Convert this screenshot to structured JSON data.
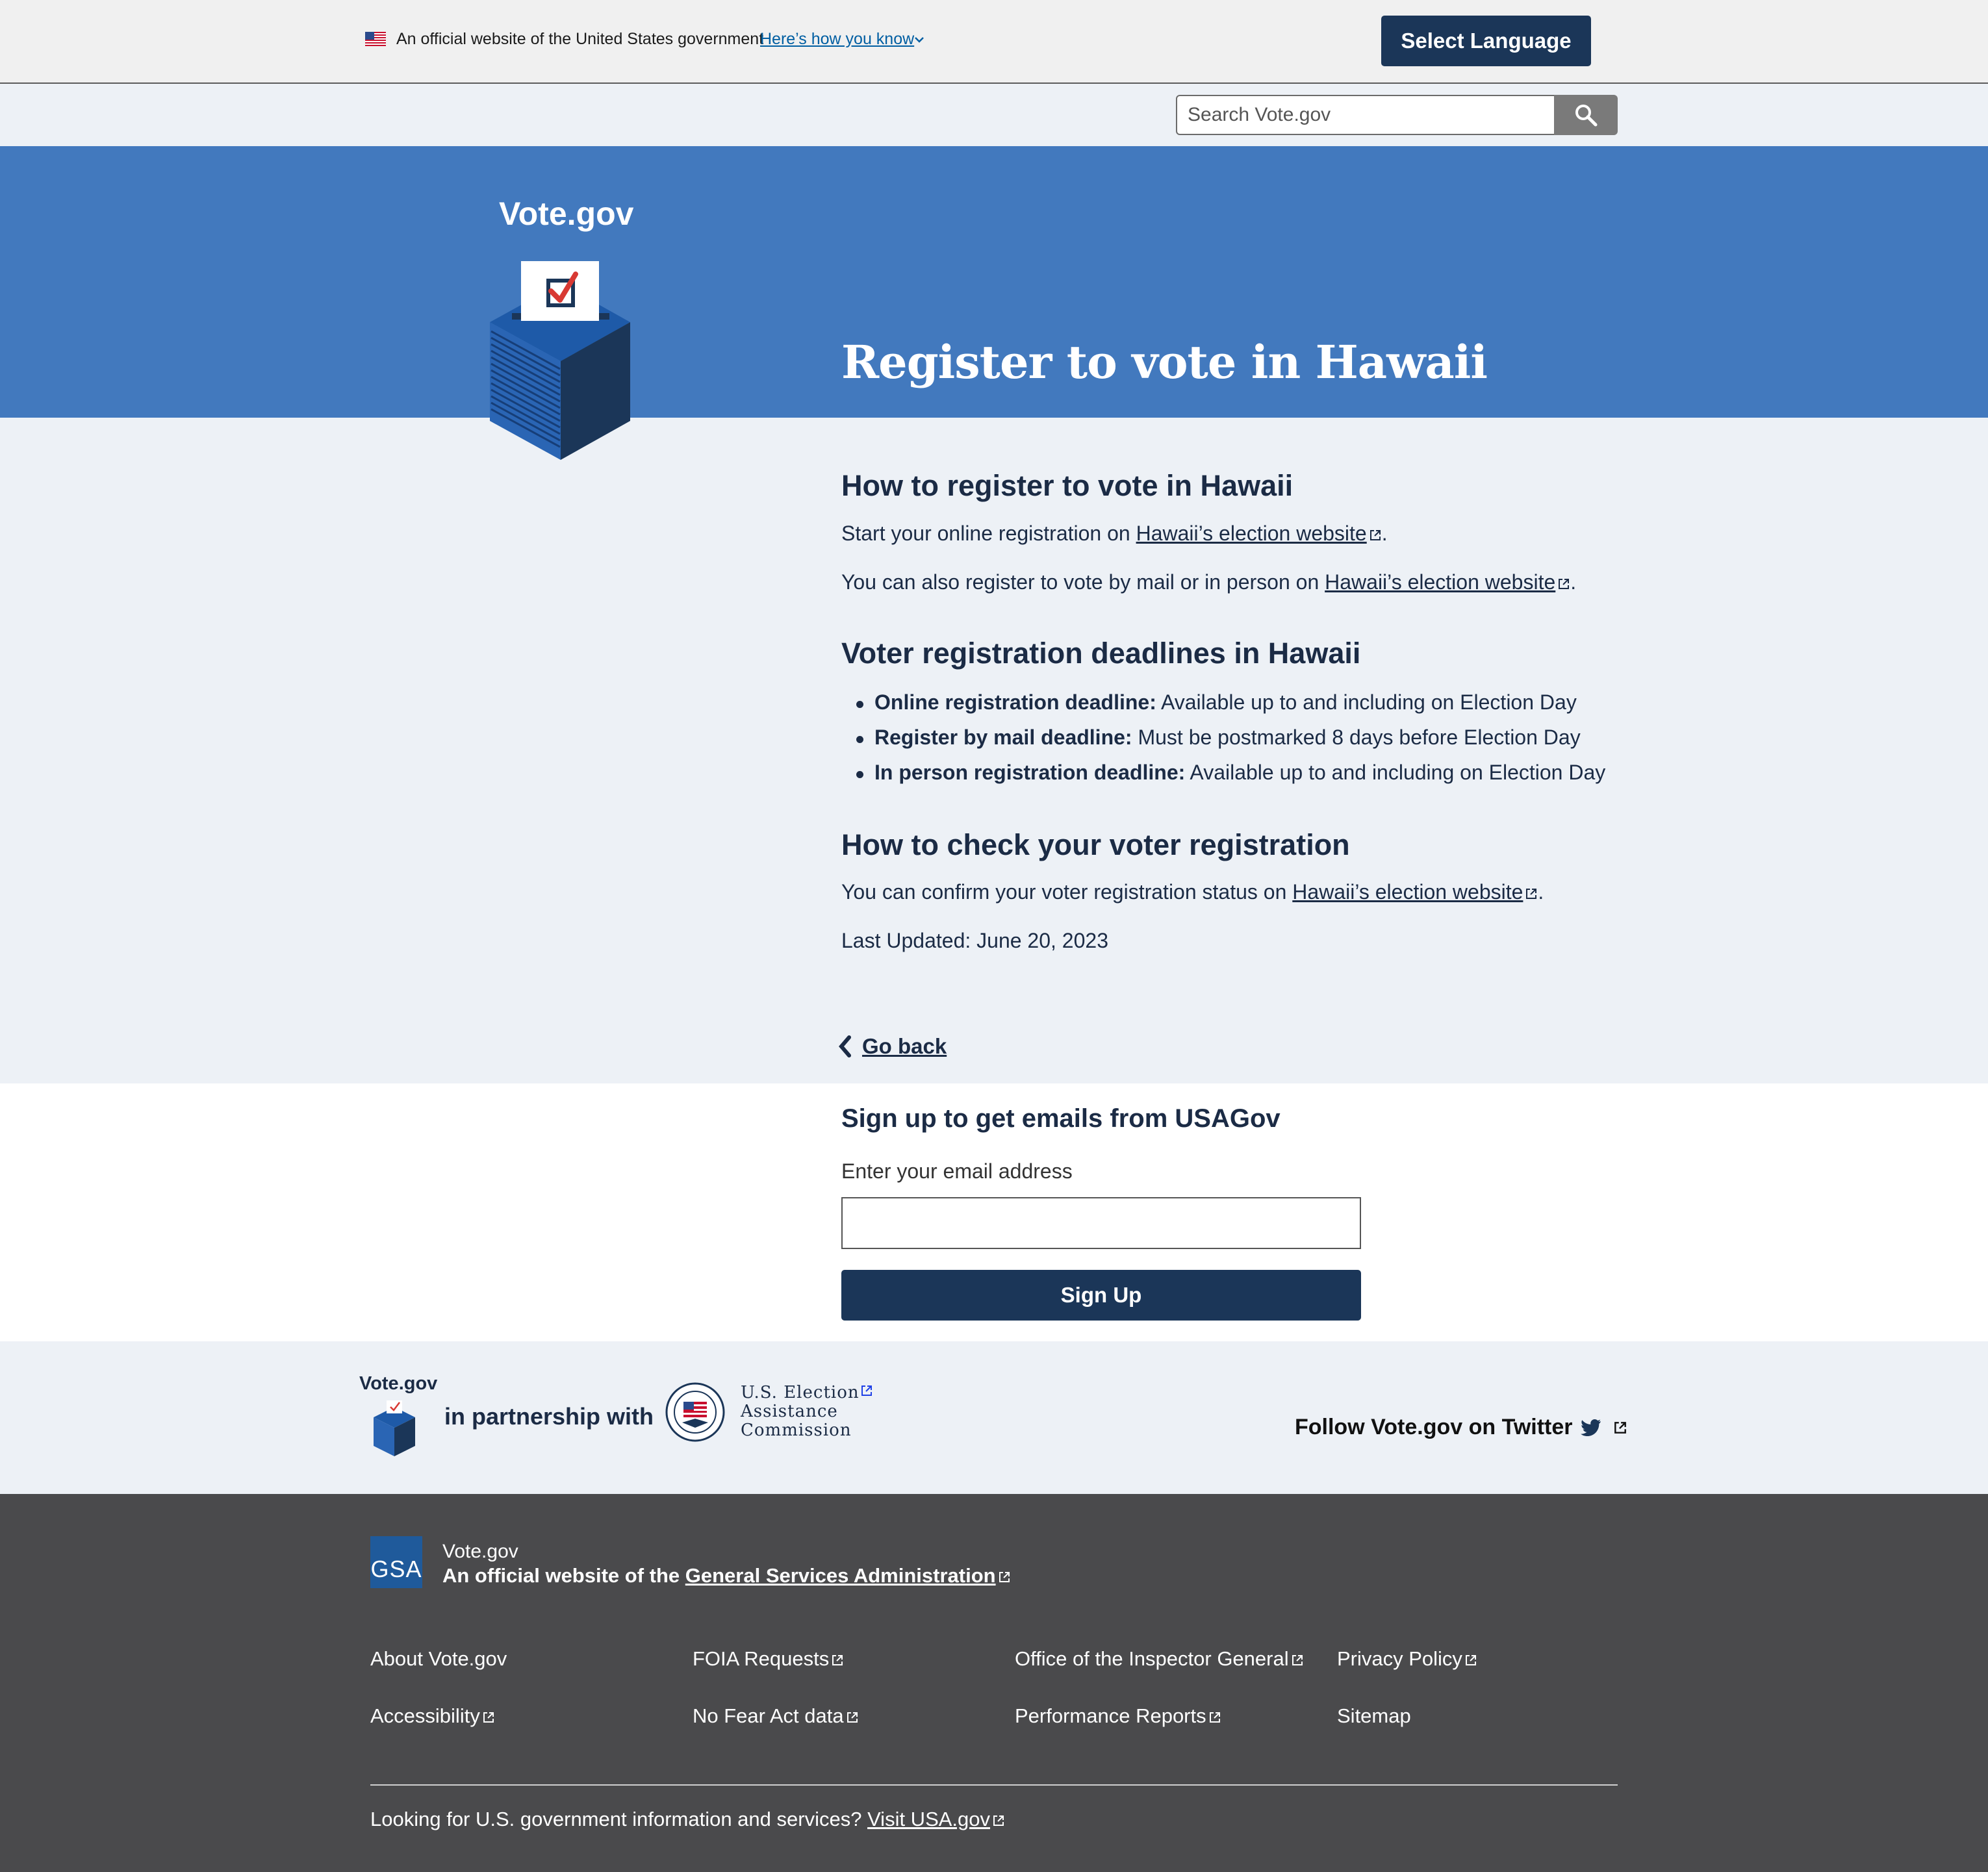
{
  "banner": {
    "official_text": "An official website of the United States government",
    "how_link": "Here’s how you know",
    "language_button": "Select Language"
  },
  "search": {
    "placeholder": "Search Vote.gov"
  },
  "hero": {
    "site_name": "Vote.gov",
    "title": "Register to vote in Hawaii"
  },
  "content": {
    "h_register": "How to register to vote in Hawaii",
    "p_online_pre": "Start your online registration on ",
    "p_mail_pre": "You can also register to vote by mail or in person on ",
    "election_link": "Hawaii’s election website",
    "period": ".",
    "h_deadlines": "Voter registration deadlines in Hawaii",
    "deadlines": [
      {
        "label": "Online registration deadline:",
        "text": " Available up to and including on Election Day"
      },
      {
        "label": "Register by mail deadline:",
        "text": " Must be postmarked 8 days before Election Day"
      },
      {
        "label": "In person registration deadline:",
        "text": " Available up to and including on Election Day"
      }
    ],
    "h_check": "How to check your voter registration",
    "p_check_pre": "You can confirm your voter registration status on ",
    "last_updated": "Last Updated: June 20, 2023",
    "go_back": "Go back"
  },
  "signup": {
    "title": "Sign up to get emails from USAGov",
    "label": "Enter your email address",
    "button": "Sign Up"
  },
  "partners": {
    "vote_gov": "Vote.gov",
    "with": "in partnership with",
    "eac": [
      "U.S. Election",
      "Assistance",
      "Commission"
    ],
    "twitter": "Follow Vote.gov on Twitter"
  },
  "footer": {
    "logo": "GSA",
    "site": "Vote.gov",
    "official_pre": "An official website of the ",
    "gsa_link": "General Services Administration",
    "links": [
      "About Vote.gov",
      "FOIA Requests",
      "Office of the Inspector General",
      "Privacy Policy",
      "Accessibility",
      "No Fear Act data",
      "Performance Reports",
      "Sitemap"
    ],
    "usa_pre": "Looking for U.S. government information and services? ",
    "usa_link": "Visit USA.gov"
  },
  "colors": {
    "hero": "#4279be",
    "navy": "#1b3658",
    "footer": "#4a4a4c",
    "light_bg": "#edf1f6"
  }
}
